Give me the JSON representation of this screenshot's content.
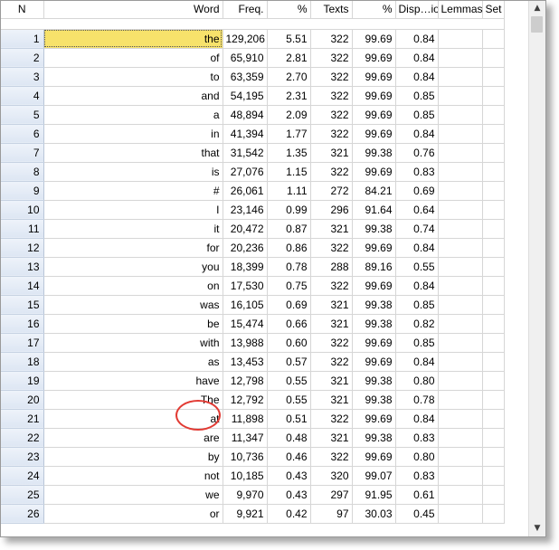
{
  "columns": {
    "n": "N",
    "word": "Word",
    "freq": "Freq.",
    "pct": "%",
    "texts": "Texts",
    "texts_pct": "%",
    "dispersion": "Disp…ion",
    "lemmas": "Lemmas",
    "set": "Set"
  },
  "rows": [
    {
      "n": "1",
      "word": "the",
      "freq": "129,206",
      "pct": "5.51",
      "texts": "322",
      "texts_pct": "99.69",
      "dispersion": "0.84"
    },
    {
      "n": "2",
      "word": "of",
      "freq": "65,910",
      "pct": "2.81",
      "texts": "322",
      "texts_pct": "99.69",
      "dispersion": "0.84"
    },
    {
      "n": "3",
      "word": "to",
      "freq": "63,359",
      "pct": "2.70",
      "texts": "322",
      "texts_pct": "99.69",
      "dispersion": "0.84"
    },
    {
      "n": "4",
      "word": "and",
      "freq": "54,195",
      "pct": "2.31",
      "texts": "322",
      "texts_pct": "99.69",
      "dispersion": "0.85"
    },
    {
      "n": "5",
      "word": "a",
      "freq": "48,894",
      "pct": "2.09",
      "texts": "322",
      "texts_pct": "99.69",
      "dispersion": "0.85"
    },
    {
      "n": "6",
      "word": "in",
      "freq": "41,394",
      "pct": "1.77",
      "texts": "322",
      "texts_pct": "99.69",
      "dispersion": "0.84"
    },
    {
      "n": "7",
      "word": "that",
      "freq": "31,542",
      "pct": "1.35",
      "texts": "321",
      "texts_pct": "99.38",
      "dispersion": "0.76"
    },
    {
      "n": "8",
      "word": "is",
      "freq": "27,076",
      "pct": "1.15",
      "texts": "322",
      "texts_pct": "99.69",
      "dispersion": "0.83"
    },
    {
      "n": "9",
      "word": "#",
      "freq": "26,061",
      "pct": "1.11",
      "texts": "272",
      "texts_pct": "84.21",
      "dispersion": "0.69"
    },
    {
      "n": "10",
      "word": "I",
      "freq": "23,146",
      "pct": "0.99",
      "texts": "296",
      "texts_pct": "91.64",
      "dispersion": "0.64"
    },
    {
      "n": "11",
      "word": "it",
      "freq": "20,472",
      "pct": "0.87",
      "texts": "321",
      "texts_pct": "99.38",
      "dispersion": "0.74"
    },
    {
      "n": "12",
      "word": "for",
      "freq": "20,236",
      "pct": "0.86",
      "texts": "322",
      "texts_pct": "99.69",
      "dispersion": "0.84"
    },
    {
      "n": "13",
      "word": "you",
      "freq": "18,399",
      "pct": "0.78",
      "texts": "288",
      "texts_pct": "89.16",
      "dispersion": "0.55"
    },
    {
      "n": "14",
      "word": "on",
      "freq": "17,530",
      "pct": "0.75",
      "texts": "322",
      "texts_pct": "99.69",
      "dispersion": "0.84"
    },
    {
      "n": "15",
      "word": "was",
      "freq": "16,105",
      "pct": "0.69",
      "texts": "321",
      "texts_pct": "99.38",
      "dispersion": "0.85"
    },
    {
      "n": "16",
      "word": "be",
      "freq": "15,474",
      "pct": "0.66",
      "texts": "321",
      "texts_pct": "99.38",
      "dispersion": "0.82"
    },
    {
      "n": "17",
      "word": "with",
      "freq": "13,988",
      "pct": "0.60",
      "texts": "322",
      "texts_pct": "99.69",
      "dispersion": "0.85"
    },
    {
      "n": "18",
      "word": "as",
      "freq": "13,453",
      "pct": "0.57",
      "texts": "322",
      "texts_pct": "99.69",
      "dispersion": "0.84"
    },
    {
      "n": "19",
      "word": "have",
      "freq": "12,798",
      "pct": "0.55",
      "texts": "321",
      "texts_pct": "99.38",
      "dispersion": "0.80"
    },
    {
      "n": "20",
      "word": "The",
      "freq": "12,792",
      "pct": "0.55",
      "texts": "321",
      "texts_pct": "99.38",
      "dispersion": "0.78"
    },
    {
      "n": "21",
      "word": "at",
      "freq": "11,898",
      "pct": "0.51",
      "texts": "322",
      "texts_pct": "99.69",
      "dispersion": "0.84"
    },
    {
      "n": "22",
      "word": "are",
      "freq": "11,347",
      "pct": "0.48",
      "texts": "321",
      "texts_pct": "99.38",
      "dispersion": "0.83"
    },
    {
      "n": "23",
      "word": "by",
      "freq": "10,736",
      "pct": "0.46",
      "texts": "322",
      "texts_pct": "99.69",
      "dispersion": "0.80"
    },
    {
      "n": "24",
      "word": "not",
      "freq": "10,185",
      "pct": "0.43",
      "texts": "320",
      "texts_pct": "99.07",
      "dispersion": "0.83"
    },
    {
      "n": "25",
      "word": "we",
      "freq": "9,970",
      "pct": "0.43",
      "texts": "297",
      "texts_pct": "91.95",
      "dispersion": "0.61"
    },
    {
      "n": "26",
      "word": "or",
      "freq": "9,921",
      "pct": "0.42",
      "texts": "97",
      "texts_pct": "30.03",
      "dispersion": "0.45"
    }
  ],
  "scrollbar": {
    "up_icon": "scroll-up-arrow",
    "down_icon": "scroll-down-arrow"
  },
  "colors": {
    "selected_cell": "#f7e26b",
    "highlight_circle": "#e23b34",
    "row_header": "#e4ebf5"
  }
}
